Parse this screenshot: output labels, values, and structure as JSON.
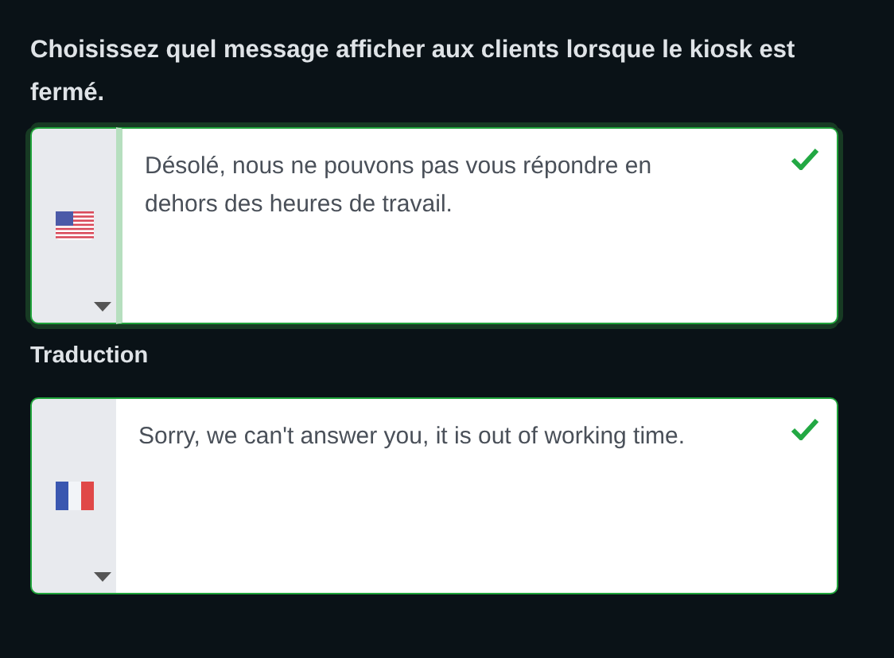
{
  "prompt": "Choisissez quel message afficher aux clients lorsque le kiosk est fermé.",
  "message_field": {
    "kind": "us",
    "text": "Désolé, nous ne pouvons pas vous répondre en dehors des heures de travail.",
    "focused": true,
    "valid": true
  },
  "translation_label": "Traduction",
  "translation_field": {
    "kind": "fr",
    "text": "Sorry, we can't answer you, it is out of working time.",
    "focused": false,
    "valid": true
  }
}
